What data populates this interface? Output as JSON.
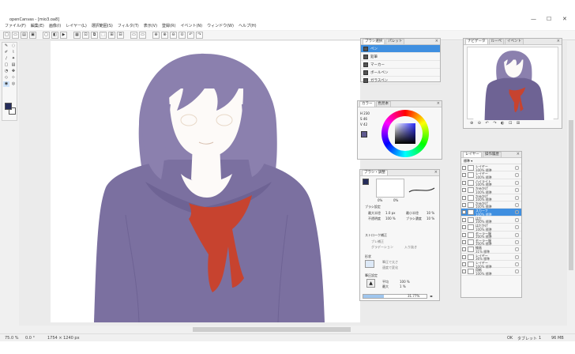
{
  "window": {
    "title": "openCanvas - [mio3.oa8]",
    "controls": [
      "—",
      "☐",
      "✕"
    ]
  },
  "menu": [
    "ファイル(F)",
    "編集(E)",
    "画像(I)",
    "レイヤー(L)",
    "選択範囲(S)",
    "フィルタ(T)",
    "表示(V)",
    "登録(R)",
    "イベント(N)",
    "ウィンドウ(W)",
    "ヘルプ(H)"
  ],
  "toolbar": {
    "icons": [
      "□",
      "▭",
      "▤",
      "▣",
      "▢",
      "◧",
      "▶",
      "▦",
      "⊡",
      "⧉",
      "⬚",
      "⊞",
      "⊟",
      "▭",
      "▭",
      "⊕",
      "⊕",
      "⊖",
      "⊙",
      "↶",
      "↷"
    ]
  },
  "tools": {
    "items": [
      "✎",
      "◌",
      "✐",
      "⌇",
      "∕",
      "✦",
      "▢",
      "▤",
      "◔",
      "✥",
      "◇",
      "⊹",
      "◉",
      "◎"
    ],
    "fg_color": "#262d5b",
    "bg_color": "#ffffff"
  },
  "brush_panel": {
    "tabs": [
      "ブラシ選択",
      "パレット"
    ],
    "items": [
      {
        "label": "ペン",
        "selected": true
      },
      {
        "label": "鉛筆",
        "selected": false
      },
      {
        "label": "マーカー",
        "selected": false
      },
      {
        "label": "ボールペン",
        "selected": false
      },
      {
        "label": "ガラスペン",
        "selected": false
      }
    ]
  },
  "color_panel": {
    "tabs": [
      "カラー",
      "色見本"
    ],
    "h_label": "H",
    "s_label": "S",
    "v_label": "V",
    "h_value": "230",
    "s_value": "46",
    "v_value": "42",
    "current_color": "#5f5a8f"
  },
  "brush_settings": {
    "tabs": [
      "ブラシ・調整"
    ],
    "size_percent_a": "0%",
    "size_percent_b": "0%",
    "section_brush": "ブラシ設定",
    "max_size_label": "最大半径",
    "max_size_value": "1.0 px",
    "min_size_label": "最小半径",
    "min_size_value": "10 %",
    "opacity_label": "不透明度",
    "opacity_value": "100 %",
    "blend_label": "ブラシ濃度",
    "blend_value": "10 %",
    "section_stroke": "ストローク補正",
    "stroke_opt1": "ブレ補正",
    "stroke_opt2": "グラデーション",
    "stroke_opt3": "入り抜き",
    "section_shape": "形状",
    "shape_opt1": "筆圧で太さ",
    "shape_opt2": "速度で変化",
    "section_pressure": "筆圧設定",
    "pressure_a_label": "平均",
    "pressure_a_value": "100 %",
    "pressure_b_label": "最大",
    "pressure_b_value": "1 %",
    "progress_value": "31.77%",
    "progress_fraction": 0.32
  },
  "navigator": {
    "tabs": [
      "ナビゲータ",
      "ルーペ",
      "イベント"
    ]
  },
  "layers": {
    "tabs": [
      "レイヤー",
      "操作履歴"
    ],
    "blend_mode": "標準",
    "rows": [
      {
        "name": "レイヤー",
        "mode": "100% 標準",
        "selected": false
      },
      {
        "name": "レイヤー",
        "mode": "100% 標準",
        "selected": false
      },
      {
        "name": "ハイライト",
        "mode": "100% 標準",
        "selected": false
      },
      {
        "name": "かみかげ",
        "mode": "100% 標準",
        "selected": false
      },
      {
        "name": "かみかげ",
        "mode": "100% 標準",
        "selected": false
      },
      {
        "name": "かみかげ",
        "mode": "100% 標準",
        "selected": false
      },
      {
        "name": "スカーフ",
        "mode": "100% 標準",
        "selected": true
      },
      {
        "name": "はだ",
        "mode": "100% 標準",
        "selected": false
      },
      {
        "name": "はだかげ",
        "mode": "100% 標準",
        "selected": false
      },
      {
        "name": "セーラー服",
        "mode": "100% 標準",
        "selected": false
      },
      {
        "name": "セーラー服",
        "mode": "100% 標準",
        "selected": false
      },
      {
        "name": "線画",
        "mode": "31% 標準",
        "selected": false
      },
      {
        "name": "レイヤー",
        "mode": "36% 標準",
        "selected": false
      },
      {
        "name": "レイヤー",
        "mode": "100% 標準",
        "selected": false
      },
      {
        "name": "用紙",
        "mode": "100% 標準",
        "selected": false
      }
    ]
  },
  "status": {
    "zoom": "75.0 %",
    "angle": "0.0 °",
    "size": "1754 × 1240 px",
    "mode_a": "OK",
    "device": "タブレット",
    "mode_b": "1",
    "mem": "96 MB"
  }
}
